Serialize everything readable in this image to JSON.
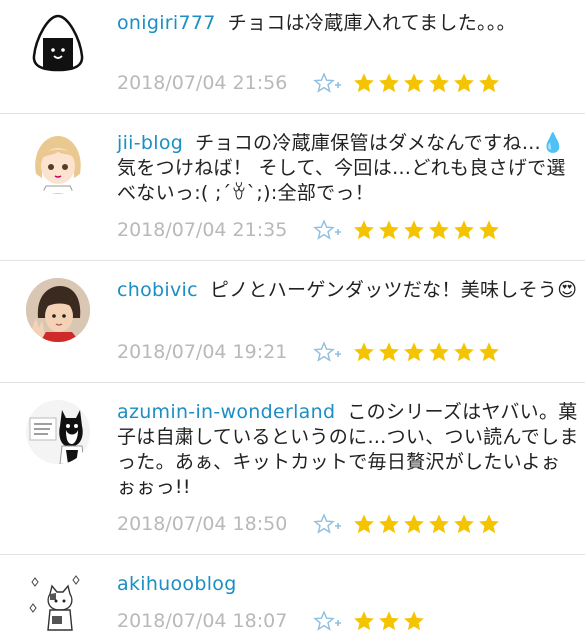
{
  "comments": [
    {
      "username": "onigiri777",
      "text": "チョコは冷蔵庫入れてました。。。",
      "date": "2018/07/04 21:56",
      "star_count": 6,
      "avatar_icon": "onigiri-icon"
    },
    {
      "username": "jii-blog",
      "text": "チョコの冷蔵庫保管はダメなんですね…💧気をつけねば！ そして、今回は…どれも良さげで選べないっ:( ;´ꈊ`;):全部でっ！",
      "date": "2018/07/04 21:35",
      "star_count": 6,
      "avatar_icon": "anime-girl-icon"
    },
    {
      "username": "chobivic",
      "text": "ピノとハーゲンダッツだな！美味しそう😍",
      "date": "2018/07/04 19:21",
      "star_count": 6,
      "avatar_icon": "child-peace-sign-icon"
    },
    {
      "username": "azumin-in-wonderland",
      "text": "このシリーズはヤバい。菓子は自粛しているというのに…つい、つい読んでしまった。あぁ、キットカットで毎日贅沢がしたいよぉぉぉっ!!",
      "date": "2018/07/04 18:50",
      "star_count": 6,
      "avatar_icon": "cat-illustration-icon"
    },
    {
      "username": "akihuooblog",
      "text": "",
      "date": "2018/07/04 18:07",
      "star_count": 3,
      "avatar_icon": "cat-doodle-icon"
    }
  ],
  "colors": {
    "username": "#1b8fc4",
    "star": "#f5c400",
    "add_star": "#8fbfe0",
    "date": "#b9b9b9"
  },
  "icons": {
    "add_star": "add-star-icon",
    "star": "star-icon"
  }
}
